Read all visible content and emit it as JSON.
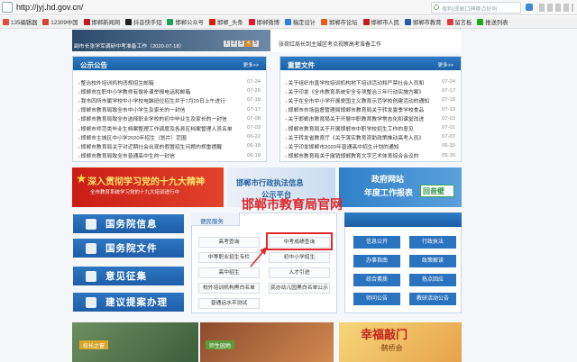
{
  "browser": {
    "url": "http://jyj.hd.gov.cn/",
    "search_placeholder": "搜狗|邯郸口碑哪点好吗",
    "bookmarks": [
      {
        "label": "135编辑器",
        "color": "#e24a3c"
      },
      {
        "label": "12309中国",
        "color": "#d8432f"
      },
      {
        "label": "邯郸新闻网",
        "color": "#c41a1a"
      },
      {
        "label": "抖音快手短",
        "color": "#222222"
      },
      {
        "label": "邯郸公众号",
        "color": "#1aa356"
      },
      {
        "label": "邯郸_头条",
        "color": "#d81e06"
      },
      {
        "label": "邯郸微博",
        "color": "#e6162d"
      },
      {
        "label": "稿定设计",
        "color": "#2f7de1"
      },
      {
        "label": "邯郸市论坛",
        "color": "#e85a1a"
      },
      {
        "label": "邯郸市人民",
        "color": "#c41a1a"
      },
      {
        "label": "邯郸市教育",
        "color": "#1f5ea8"
      },
      {
        "label": "留言板",
        "color": "#e4393c"
      },
      {
        "label": "推送列表",
        "color": "#1aad19"
      }
    ]
  },
  "slide": {
    "caption": "副市长张学军调研中考准备工作（2020-07-18）",
    "pages": [
      "1",
      "2",
      "3",
      "4",
      "5"
    ],
    "active_index": 3
  },
  "top_news": "张荷红局长到主城区考点视察高考准备工作",
  "announcements": {
    "title": "公示公告",
    "more": "更多>>",
    "items": [
      {
        "t": "整治校外培训机构违规招生邮箱",
        "d": "07-24"
      },
      {
        "t": "邯郸市在职中小学教师有偿补课举报电话和邮箱",
        "d": "07-20"
      },
      {
        "t": "我市四所市属学校中小学校电脑班位招生并于7月20日上午进行",
        "d": "07-18"
      },
      {
        "t": "邯郸市教育局致全市中小学生及家长的一封信",
        "d": "07-17"
      },
      {
        "t": "邯郸市教育局致全市选择职业学校的初中毕业生及家长的一封信",
        "d": "07-08"
      },
      {
        "t": "邯郸市师范类毕业生档案整理工作调度及各县区档案管理人员名单",
        "d": "07-03"
      },
      {
        "t": "邯郸市主城区中小学2020年招生（划片）范围",
        "d": "06-22"
      },
      {
        "t": "邯郸市教育局关于对近期社会出现的假冒招生问题的郑重提醒",
        "d": "06-19"
      },
      {
        "t": "邯郸市教育局致全市普通高中生的一封信",
        "d": "06-18"
      }
    ]
  },
  "documents": {
    "title": "重要文件",
    "more": "更多>>",
    "items": [
      {
        "t": "关于组织市直学校培训机构地下培训活动和严禁社会人员和",
        "d": "07-24"
      },
      {
        "t": "关于印发《全市教育系统安全专项整治三年行动实施方案》",
        "d": "07-17"
      },
      {
        "t": "关于在全市中小学开展爱国主义教育示范学校创建活动的通知",
        "d": "07-15"
      },
      {
        "t": "邯郸市市场监督管理局邯郸市教育局关于转发夏季学校食品",
        "d": "07-13"
      },
      {
        "t": "关于邯郸市教育局关于开展中职教育教学常态化和课堂改进",
        "d": "07-03"
      },
      {
        "t": "邯郸市教育局关于开展邯郸市中职学校招生工作的意见",
        "d": "07-01"
      },
      {
        "t": "关于转发省教育厅《关于落实教育资助政策推动高考人员》",
        "d": "07-07"
      },
      {
        "t": "关于印发邯郸市2020年普通高中招生计划的通知",
        "d": "06-30"
      },
      {
        "t": "邯郸市教育局关于撤销邯郸教育文字艺术体育综合会议的",
        "d": "06-30"
      }
    ]
  },
  "banners": {
    "b1_title": "深入贯彻学习党的十九大精神",
    "b1_sub": "全市教育系统学习党的十九大培训进行中",
    "b2_line1": "邯郸市行政执法信息",
    "b2_line2": "公示平台",
    "b3_line1": "政府网站",
    "b3_line2": "年度工作报表",
    "b3_logo": "回音壁"
  },
  "overlay_text": "邯郸市教育局官网",
  "left_buttons": [
    "国务院信息",
    "国务院文件",
    "意见征集",
    "建议提案办理"
  ],
  "services": {
    "tab": "便民服务",
    "items": [
      "高考查询",
      "中考成绩查询",
      "中等职业招生专栏",
      "初中小学招生",
      "高中招生",
      "人才引进",
      "校外培训机构黑白名单",
      "民办幼儿园黑白名单公示",
      "普通话水平测试"
    ]
  },
  "quick_links": [
    "信息公开",
    "行政执法",
    "办事指南",
    "政策解读",
    "综合素质",
    "热点回应",
    "师问公告",
    "教研活动公告"
  ],
  "bottom": {
    "p1_label": "校长之窗",
    "p2_label": "师生园地",
    "p3_title": "幸福敲门",
    "p3_sub": "·鹊桥会"
  }
}
